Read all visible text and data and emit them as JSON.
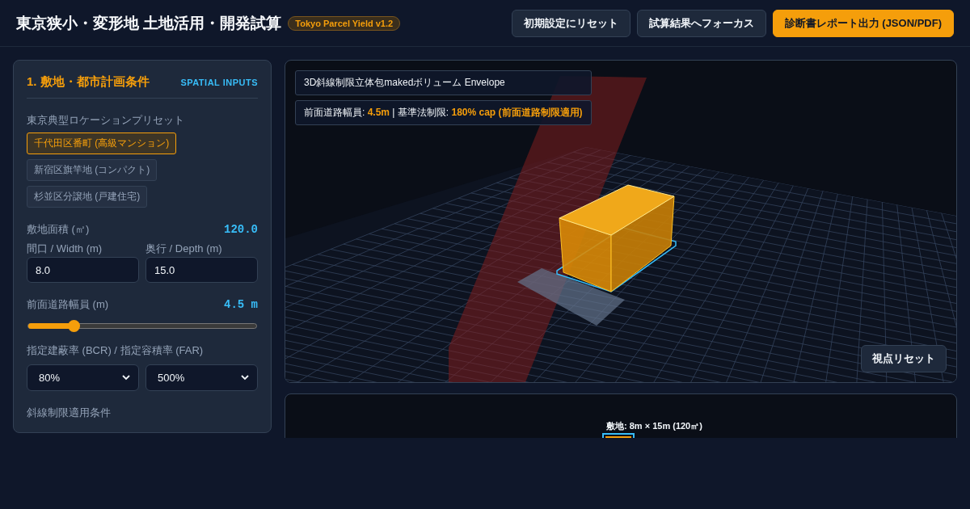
{
  "header": {
    "title": "東京狭小・変形地 土地活用・開発試算",
    "badge": "Tokyo Parcel Yield v1.2",
    "buttons": [
      {
        "label": "初期設定にリセット",
        "kind": "secondary"
      },
      {
        "label": "試算結果へフォーカス",
        "kind": "secondary"
      },
      {
        "label": "診断書レポート出力 (JSON/PDF)",
        "kind": "primary"
      }
    ]
  },
  "inputs": {
    "title": "1. 敷地・都市計画条件",
    "tag": "SPATIAL INPUTS",
    "preset_label": "東京典型ロケーションプリセット",
    "presets": [
      {
        "label": "千代田区番町 (高級マンション)",
        "selected": true
      },
      {
        "label": "新宿区旗竿地 (コンパクト)",
        "selected": false
      },
      {
        "label": "杉並区分譲地 (戸建住宅)",
        "selected": false
      }
    ],
    "site_area": {
      "label": "敷地面積 (㎡)",
      "value": "120.0"
    },
    "width": {
      "label": "間口 / Width (m)",
      "value": "8.0"
    },
    "depth": {
      "label": "奥行 / Depth (m)",
      "value": "15.0"
    },
    "road_width": {
      "label": "前面道路幅員 (m)",
      "reading": "4.5 m",
      "level": 0.2
    },
    "ratios": {
      "label": "指定建蔽率 (BCR) / 指定容積率 (FAR)",
      "bcr": "80%",
      "far": "500%"
    },
    "setback_label": "斜線制限適用条件"
  },
  "viewer": {
    "title": "3D斜線制限立体包makedボリューム Envelope",
    "info": [
      {
        "text": "前面道路幅員: ",
        "highlight": false
      },
      {
        "text": "4.5m",
        "highlight": true
      },
      {
        "text": " | 基準法制限: ",
        "highlight": false
      },
      {
        "text": "180% cap (前面道路制限適用)",
        "highlight": true
      }
    ],
    "reset_button": "視点リセット"
  },
  "plan": {
    "label": "敷地: 8m × 15m (120㎡)"
  }
}
